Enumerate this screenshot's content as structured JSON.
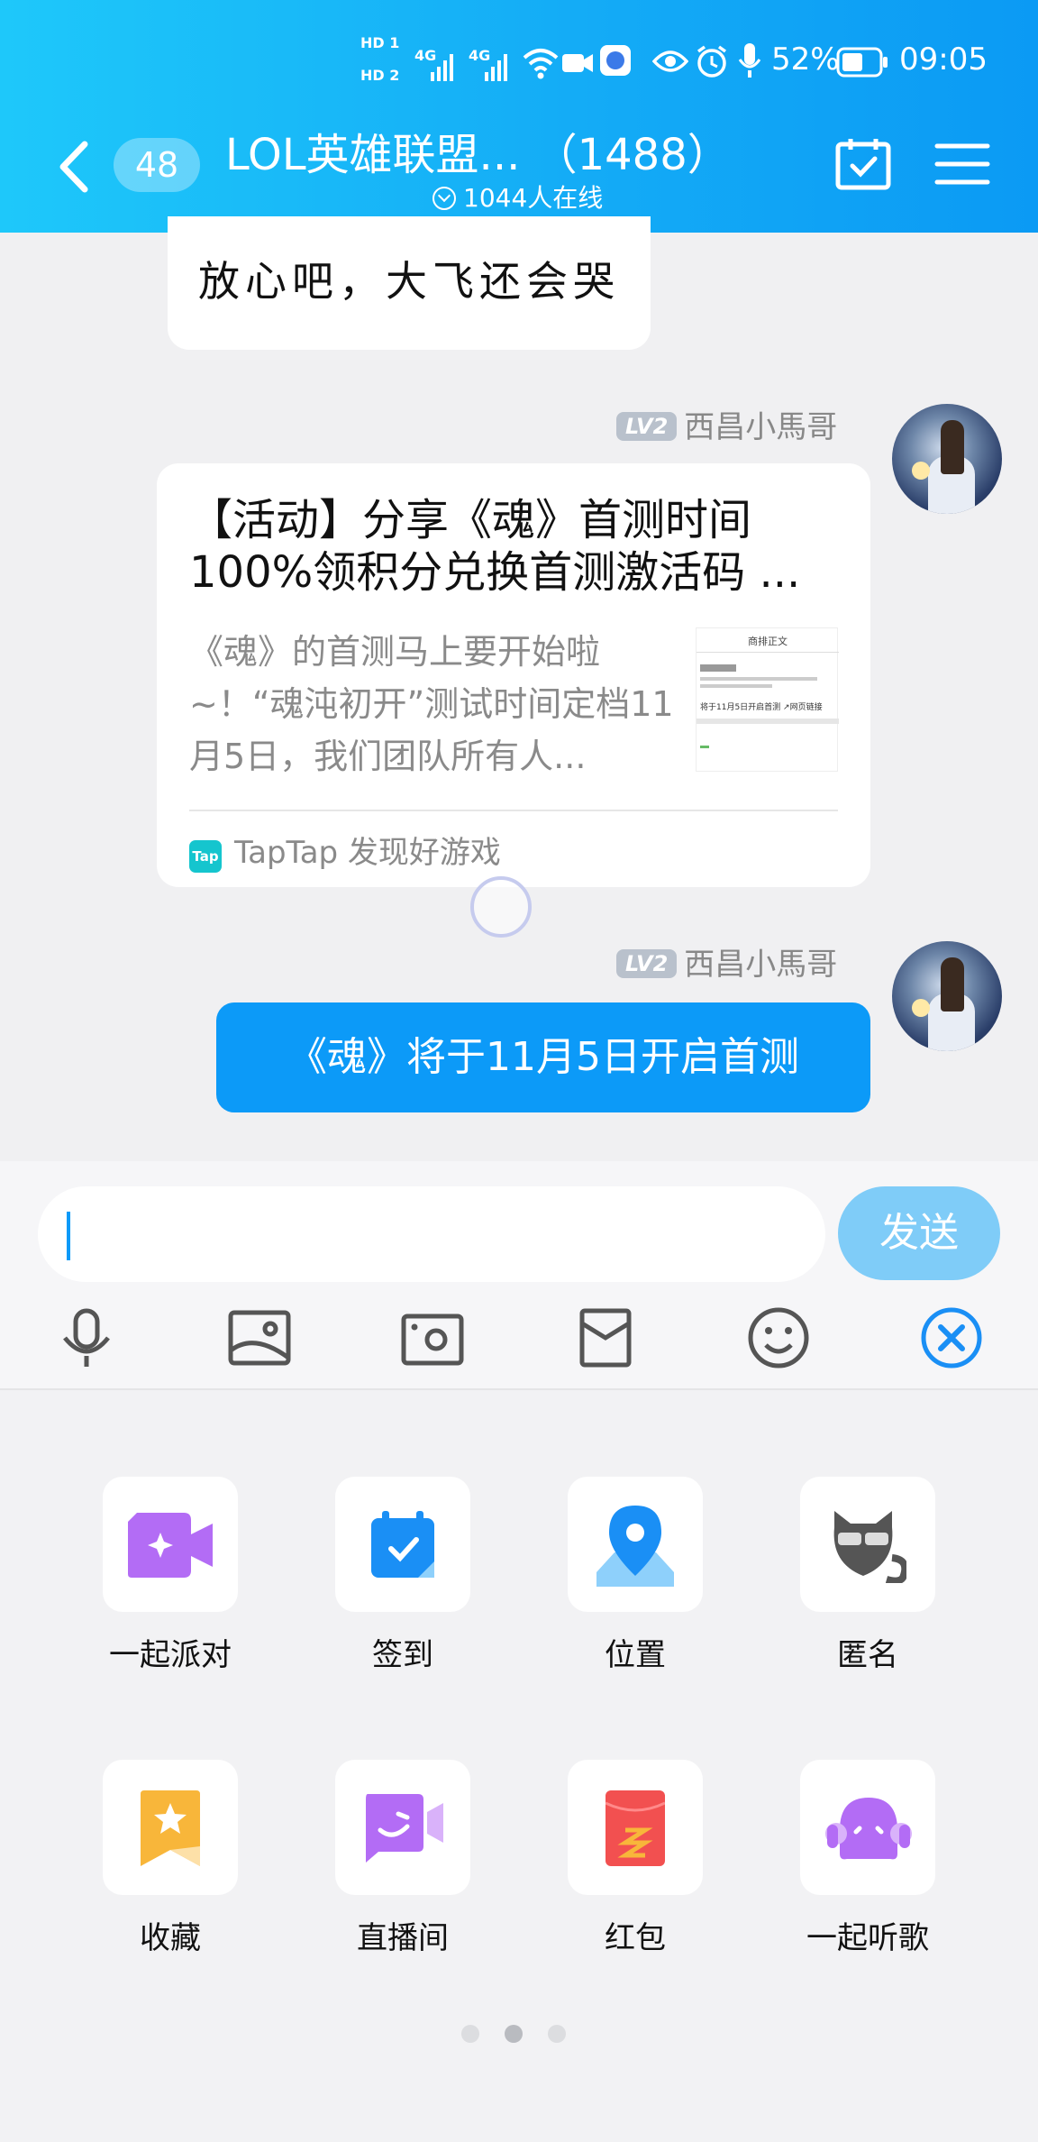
{
  "status_bar": {
    "hd1": "HD 1",
    "hd2": "HD 2",
    "net1": "4G",
    "net2": "4G",
    "battery": "52%",
    "time": "09:05"
  },
  "header": {
    "unread_count": "48",
    "group_name": "LOL英雄联盟...  （1488）",
    "online_count": "1044人在线"
  },
  "messages": [
    {
      "type": "text",
      "text": "放心吧，大飞还会哭"
    },
    {
      "type": "share_card",
      "level": "LV2",
      "sender": "西昌小馬哥",
      "title": "【活动】分享《魂》首测时间100%领积分兑换首测激活码 ...",
      "description": "《魂》的首测马上要开始啦~！“魂沌初开”测试时间定档11月5日，我们团队所有人...",
      "thumb_heading": "商排正文",
      "thumb_line": "将于11月5日开启首测 ↗网页链接",
      "source_logo": "Tap",
      "source": "TapTap 发现好游戏"
    },
    {
      "type": "text",
      "level": "LV2",
      "sender": "西昌小馬哥",
      "text": "《魂》将于11月5日开启首测"
    }
  ],
  "composer": {
    "input_value": "",
    "send_label": "发送"
  },
  "apps": [
    {
      "label": "一起派对",
      "icon": "party-video-icon",
      "color": "#b36cf5"
    },
    {
      "label": "签到",
      "icon": "checkin-calendar-icon",
      "color": "#1a8ff5"
    },
    {
      "label": "位置",
      "icon": "location-pin-icon",
      "color": "#1a8ff5"
    },
    {
      "label": "匿名",
      "icon": "anonymous-cat-icon",
      "color": "#555555"
    },
    {
      "label": "收藏",
      "icon": "favorite-bookmark-icon",
      "color": "#f8b63a"
    },
    {
      "label": "直播间",
      "icon": "live-room-icon",
      "color": "#b36cf5"
    },
    {
      "label": "红包",
      "icon": "red-packet-icon",
      "color": "#f25050"
    },
    {
      "label": "一起听歌",
      "icon": "listen-music-icon",
      "color": "#b36cf5"
    }
  ],
  "pager": {
    "count": 3,
    "active": 1
  },
  "colors": {
    "header_start": "#1ec8fa",
    "header_end": "#0b9af4",
    "bubble_blue": "#0c9af8",
    "send_button": "#7fccf8"
  }
}
